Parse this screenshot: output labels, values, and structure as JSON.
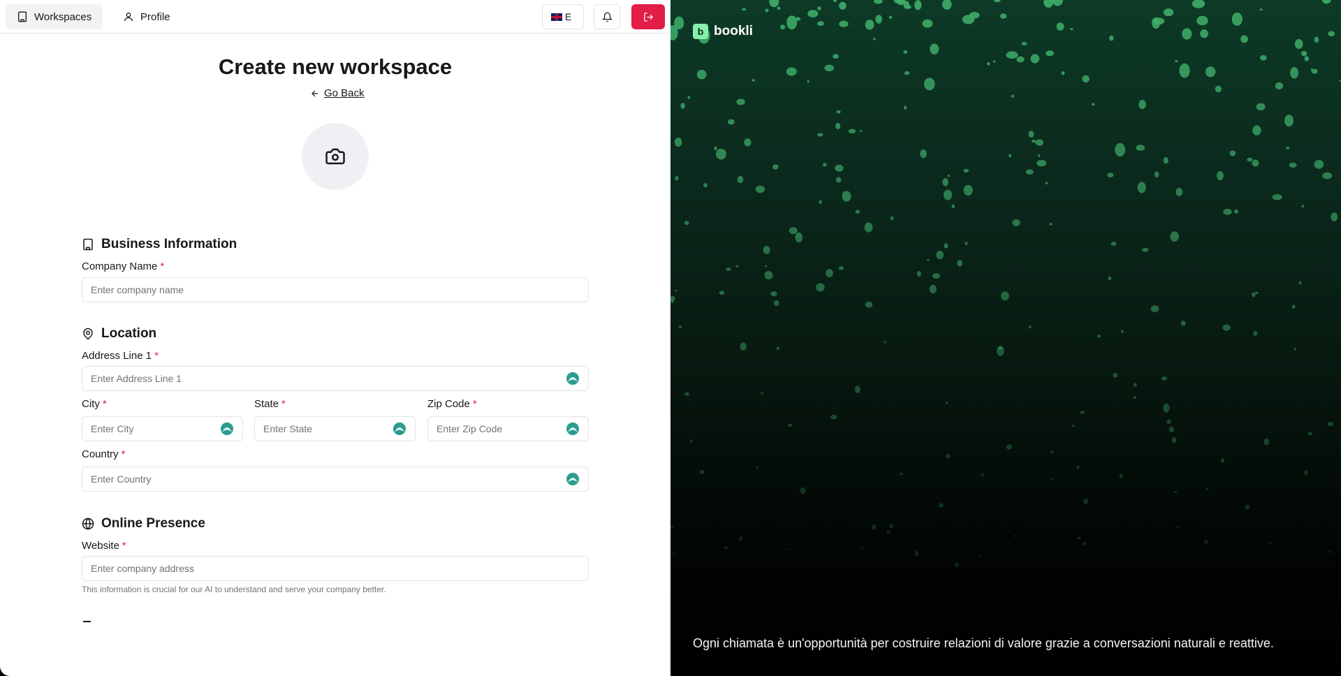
{
  "topbar": {
    "workspaces_label": "Workspaces",
    "profile_label": "Profile",
    "language_label": "E",
    "logout_color": "#e11d48"
  },
  "header": {
    "title": "Create new workspace",
    "go_back": "Go Back"
  },
  "business": {
    "heading": "Business Information",
    "company_name_label": "Company Name",
    "company_name_placeholder": "Enter company name"
  },
  "location": {
    "heading": "Location",
    "address1_label": "Address Line 1",
    "address1_placeholder": "Enter Address Line 1",
    "city_label": "City",
    "city_placeholder": "Enter City",
    "state_label": "State",
    "state_placeholder": "Enter State",
    "zip_label": "Zip Code",
    "zip_placeholder": "Enter Zip Code",
    "country_label": "Country",
    "country_placeholder": "Enter Country"
  },
  "online": {
    "heading": "Online Presence",
    "website_label": "Website",
    "website_placeholder": "Enter company address",
    "hint": "This information is crucial for our AI to understand and serve your company better."
  },
  "required_mark": "*",
  "side": {
    "brand_letter": "b",
    "brand_name": "bookli",
    "quote": "Ogni chiamata è un'opportunità per costruire relazioni di valore grazie a conversazioni naturali e reattive.",
    "accent": "#86efac"
  }
}
